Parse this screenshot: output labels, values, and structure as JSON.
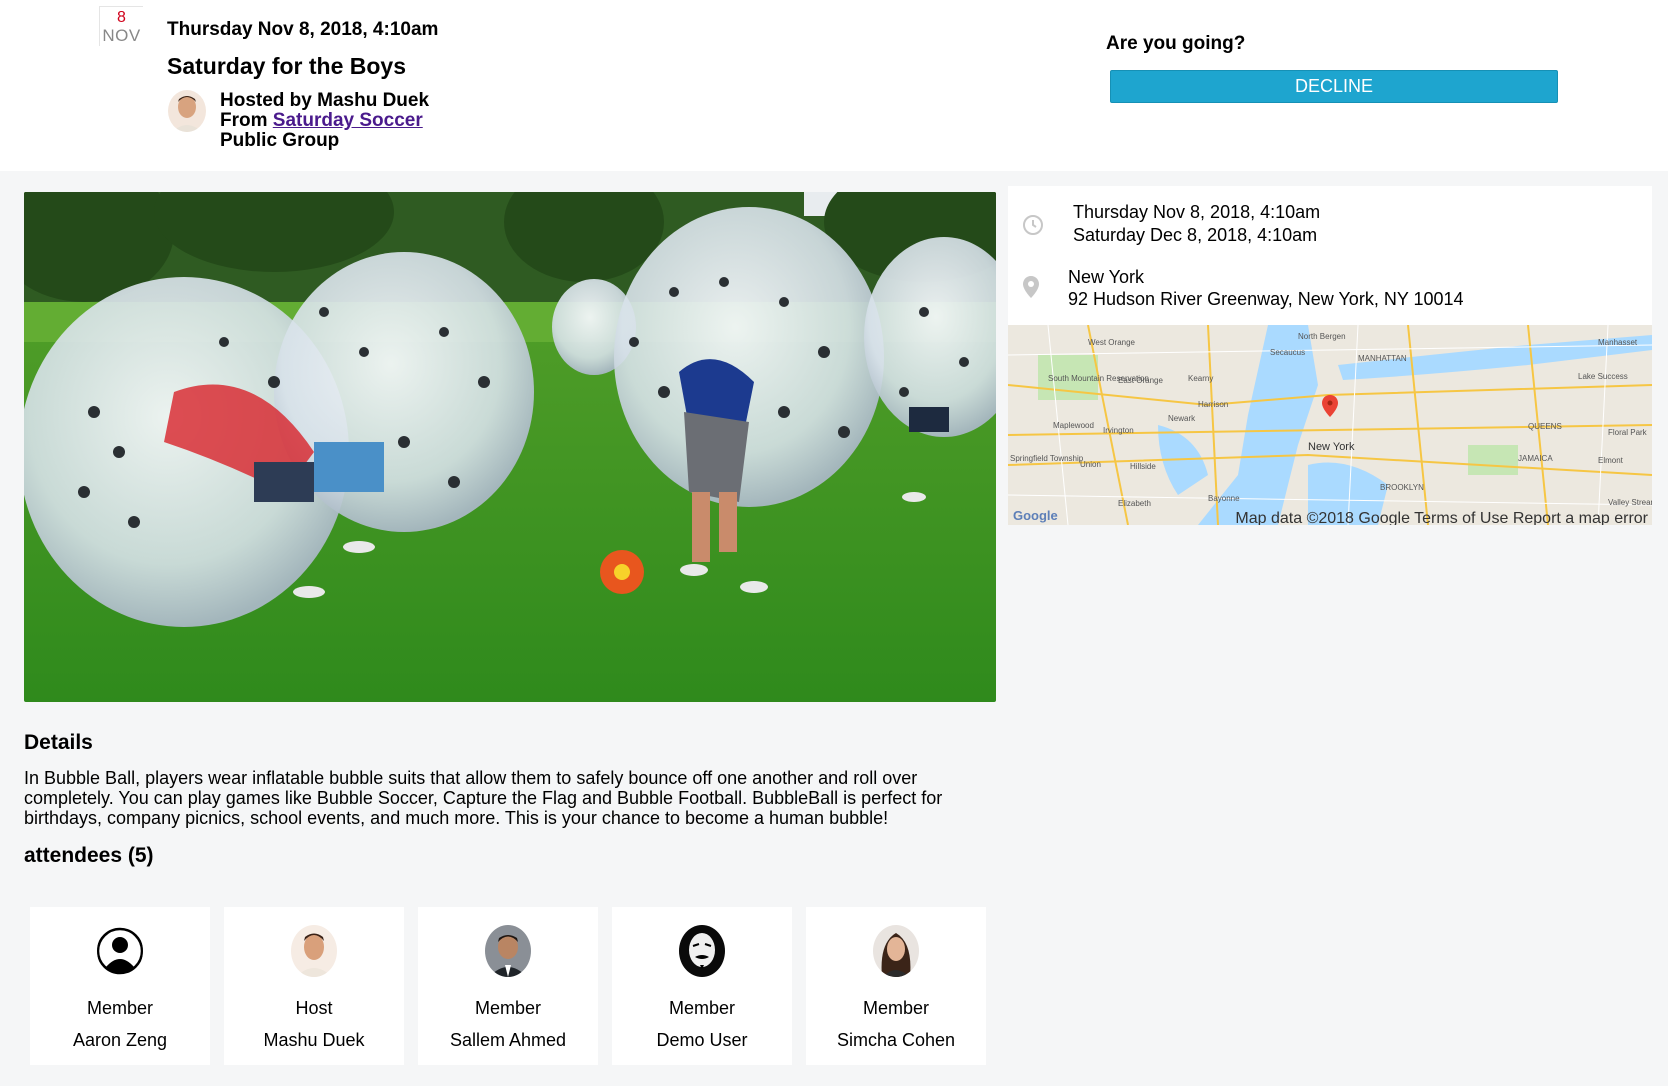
{
  "header": {
    "badge_day": "8",
    "badge_month": "NOV",
    "datetime": "Thursday Nov 8, 2018, 4:10am",
    "title": "Saturday for the Boys",
    "hosted_by": "Hosted by Mashu Duek",
    "from_prefix": "From ",
    "group_link": "Saturday Soccer",
    "group_type": "Public Group"
  },
  "rsvp": {
    "question": "Are you going?",
    "decline_label": "DECLINE"
  },
  "info": {
    "start": "Thursday Nov 8, 2018, 4:10am",
    "end": "Saturday Dec 8, 2018, 4:10am",
    "city": "New York",
    "address": "92 Hudson River Greenway, New York, NY 10014",
    "clock_icon": "clock-icon",
    "pin_icon": "location-pin-icon"
  },
  "map": {
    "credits": "Map data ©2018 Google  Terms of Use  Report a map error",
    "logo": "Google",
    "labels": [
      "North Bergen",
      "West Orange",
      "Secaucus",
      "MANHATTAN",
      "East Orange",
      "Kearny",
      "South Mountain Reservation",
      "Harrison",
      "Newark",
      "Maplewood",
      "Irvington",
      "New York",
      "QUEENS",
      "Springfield Township",
      "Union",
      "Hillside",
      "BROOKLYN",
      "Elizabeth",
      "Bayonne",
      "Lake Success",
      "Floral Park",
      "Elmont",
      "JAMAICA",
      "Valley Stream",
      "Manhasset"
    ]
  },
  "details": {
    "heading": "Details",
    "text": "In Bubble Ball, players wear inflatable bubble suits that allow them to safely bounce off one another and roll over completely. You can play games like Bubble Soccer, Capture the Flag and Bubble Football. BubbleBall is perfect for birthdays, company picnics, school events, and much more. This is your chance to become a human bubble!"
  },
  "attendees": {
    "heading": "attendees (5)",
    "list": [
      {
        "role": "Member",
        "name": "Aaron Zeng"
      },
      {
        "role": "Host",
        "name": "Mashu Duek"
      },
      {
        "role": "Member",
        "name": "Sallem Ahmed"
      },
      {
        "role": "Member",
        "name": "Demo User"
      },
      {
        "role": "Member",
        "name": "Simcha Cohen"
      }
    ]
  },
  "colors": {
    "accent": "#1ea5cf",
    "badge_red": "#d0021b",
    "link_purple": "#4a1a8c",
    "page_bg": "#f5f6f7"
  }
}
